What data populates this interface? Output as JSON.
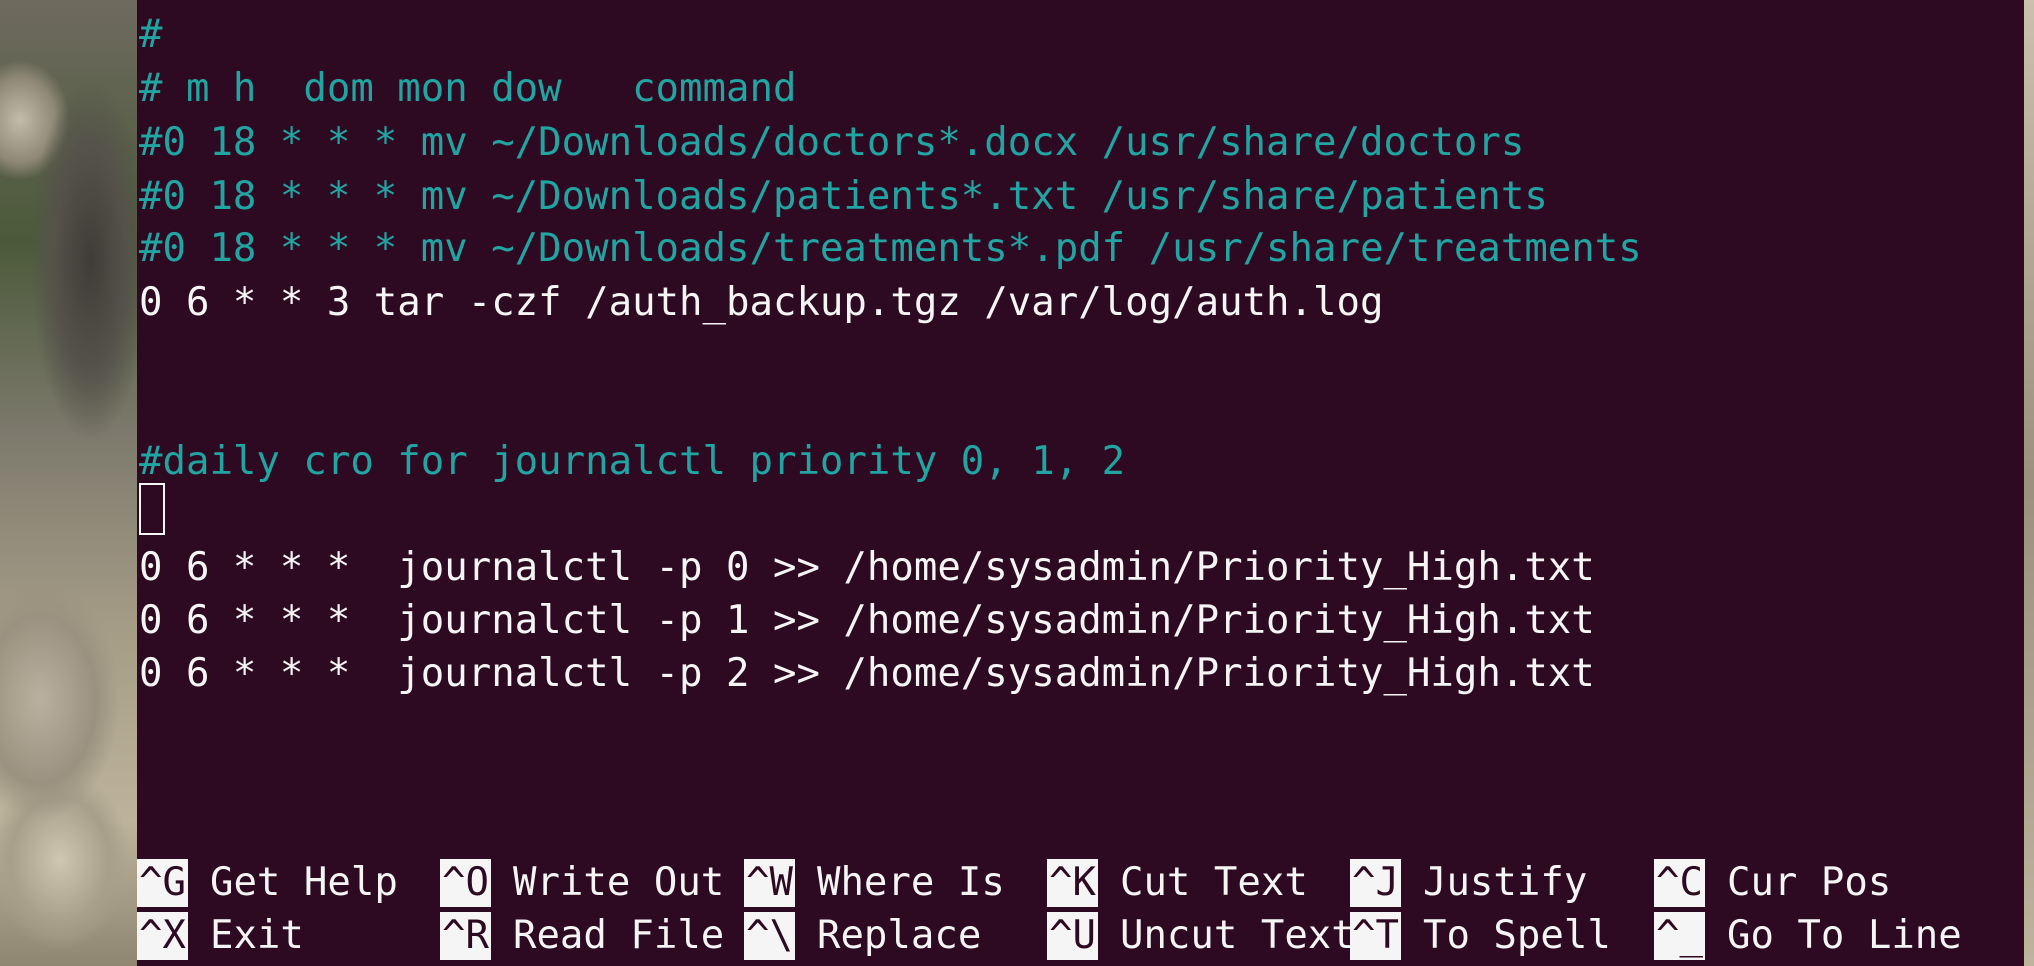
{
  "editor": {
    "lines": [
      {
        "text": "#",
        "style": "comment"
      },
      {
        "text": "# m h  dom mon dow   command",
        "style": "comment"
      },
      {
        "text": "#0 18 * * * mv ~/Downloads/doctors*.docx /usr/share/doctors",
        "style": "comment"
      },
      {
        "text": "#0 18 * * * mv ~/Downloads/patients*.txt /usr/share/patients",
        "style": "comment"
      },
      {
        "text": "#0 18 * * * mv ~/Downloads/treatments*.pdf /usr/share/treatments",
        "style": "comment"
      },
      {
        "text": "0 6 * * 3 tar -czf /auth_backup.tgz /var/log/auth.log",
        "style": "plain"
      },
      {
        "text": "",
        "style": "plain"
      },
      {
        "text": "",
        "style": "plain"
      },
      {
        "text": "#daily cro for journalctl priority 0, 1, 2",
        "style": "comment"
      },
      {
        "text": "",
        "style": "cursor"
      },
      {
        "text": "0 6 * * *  journalctl -p 0 >> /home/sysadmin/Priority_High.txt",
        "style": "plain"
      },
      {
        "text": "0 6 * * *  journalctl -p 1 >> /home/sysadmin/Priority_High.txt",
        "style": "plain"
      },
      {
        "text": "0 6 * * *  journalctl -p 2 >> /home/sysadmin/Priority_High.txt",
        "style": "plain"
      }
    ]
  },
  "shortcuts": {
    "row1": [
      {
        "key": "^G",
        "label": "Get Help"
      },
      {
        "key": "^O",
        "label": "Write Out"
      },
      {
        "key": "^W",
        "label": "Where Is"
      },
      {
        "key": "^K",
        "label": "Cut Text"
      },
      {
        "key": "^J",
        "label": "Justify"
      },
      {
        "key": "^C",
        "label": "Cur Pos"
      }
    ],
    "row2": [
      {
        "key": "^X",
        "label": "Exit"
      },
      {
        "key": "^R",
        "label": "Read File"
      },
      {
        "key": "^\\",
        "label": "Replace"
      },
      {
        "key": "^U",
        "label": "Uncut Text"
      },
      {
        "key": "^T",
        "label": "To Spell"
      },
      {
        "key": "^_",
        "label": "Go To Line"
      }
    ]
  },
  "colors": {
    "background": "#2d0a22",
    "comment": "#21a5a2",
    "text": "#f5f5f5"
  }
}
